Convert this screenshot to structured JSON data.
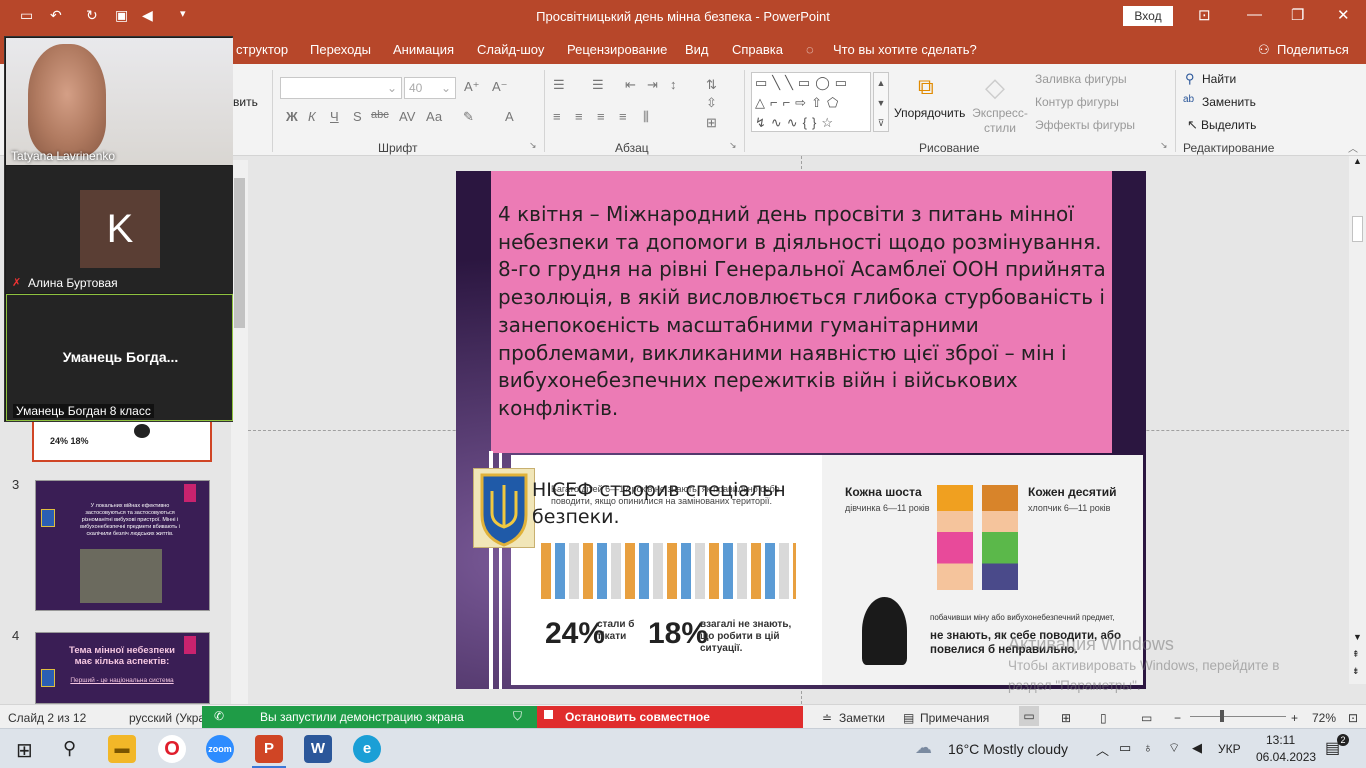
{
  "window": {
    "title": "Просвітницький день мінна безпека  -  PowerPoint",
    "signin": "Вход"
  },
  "ribbon_tabs": [
    "структор",
    "Переходы",
    "Анимация",
    "Слайд-шоу",
    "Рецензирование",
    "Вид",
    "Справка",
    "Что вы хотите сделать?"
  ],
  "share_label": "Поделиться",
  "ribbon": {
    "font_size": "40",
    "paste_partial": "вить",
    "group_font": "Шрифт",
    "group_paragraph": "Абзац",
    "group_drawing": "Рисование",
    "group_editing": "Редактирование",
    "arrange": "Упорядочить",
    "quick_styles": "Экспресс-стили",
    "shape_fill": "Заливка фигуры",
    "shape_outline": "Контур фигуры",
    "shape_effects": "Эффекты фигуры",
    "find": "Найти",
    "replace": "Заменить",
    "select": "Выделить",
    "fmt_bold": "Ж",
    "fmt_italic": "К",
    "fmt_underline": "Ч",
    "fmt_shadow": "S",
    "fmt_strike": "abc",
    "fmt_case": "Аа",
    "fmt_color": "А"
  },
  "zoom_meeting": {
    "participants": [
      {
        "name": "Tatyana Lavrinenko",
        "type": "video"
      },
      {
        "name": "Алина Буртовая",
        "initial": "K",
        "type": "avatar"
      },
      {
        "name": "Уманець Богдан 8 класс",
        "display": "Уманець  Богда...",
        "type": "text"
      }
    ]
  },
  "thumbnails": [
    {
      "number": "3",
      "text": "У локальних війнах ефективно застосовуються та застосовуються різноманітні вибухові пристрої. Мінні і вибухонебезпечні предмети вбивають і скалічили безліч людських життів."
    },
    {
      "number": "4",
      "title": "Тема мінної небезпеки має кілька аспектів:",
      "sub": "Перший - це національна система"
    }
  ],
  "slide": {
    "text": "4 квітня – Міжнародний день просвіти з питань мінної небезпеки та допомоги в діяльності щодо розмінування.\n 8-го грудня на рівні Генеральної Асамблеї ООН прийнята резолюція, в якій висловлюється глибока стурбованість і занепокоєність масштабними гуманітарними проблемами, викликаними наявністю цієї  зброї – мін і вибухонебезпечних пережитків війн і військових конфліктів.",
    "overlay_line1": "НІСЕФ створив спеціальн",
    "overlay_line2": "безпеки.",
    "infographic": {
      "header_left": "Кожна шоста",
      "header_left_sub": "дівчинка 6—11 років",
      "header_right": "Кожен десятий",
      "header_right_sub": "хлопчик 6—11 років",
      "stat1_value": "24%",
      "stat1_label": "стали б тікати",
      "stat2_value": "18%",
      "stat2_label": "взагалі не знають, що робити в цій ситуації.",
      "bottom_small": "побачивши міну або вибухонебезпечний предмет,",
      "bottom_big": "не знають, як себе поводити, або повелися б неправильно.",
      "top_caption": "Багато дітей 6—17 років не знають, як правильно себе поводити, якщо опинилися на замінованих території."
    }
  },
  "activation": {
    "line1": "Активация Windows",
    "line2": "Чтобы активировать Windows, перейдите в",
    "line3": "раздел \"Параметры\"."
  },
  "statusbar": {
    "slide_info": "Слайд 2 из 12",
    "language": "русский (Укра",
    "sharing_notice": "Вы запустили демонстрацию экрана",
    "stop_sharing": "Остановить совместное использование",
    "notes": "Заметки",
    "comments": "Примечания",
    "zoom": "72%"
  },
  "taskbar": {
    "weather": "16°C  Mostly cloudy",
    "lang": "УКР",
    "time": "13:11",
    "date": "06.04.2023",
    "notifications": "2"
  }
}
